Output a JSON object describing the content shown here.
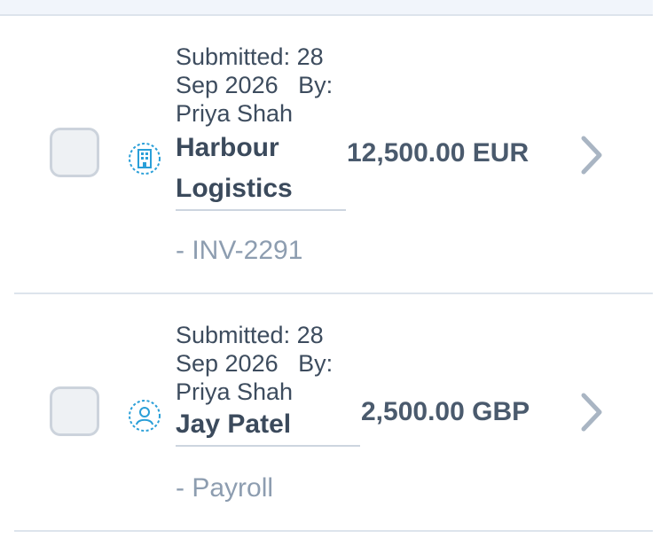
{
  "colors": {
    "icon_accent": "#2a9fd8",
    "checkbox_border": "#ccd3dc",
    "divider": "#dde4ec",
    "reference_text": "#8d9db0",
    "chevron": "#a9b5c3"
  },
  "items": [
    {
      "submitted_meta": "Submitted: 28\nSep 2026   By:\nPriya Shah",
      "icon": "building-icon",
      "name": "Harbour\nLogistics",
      "amount": "12,500.00 EUR",
      "reference": "- INV-2291"
    },
    {
      "submitted_meta": "Submitted: 28\nSep 2026   By:\nPriya Shah",
      "icon": "person-icon",
      "name": "Jay Patel",
      "amount": "2,500.00 GBP",
      "reference": "- Payroll"
    }
  ]
}
